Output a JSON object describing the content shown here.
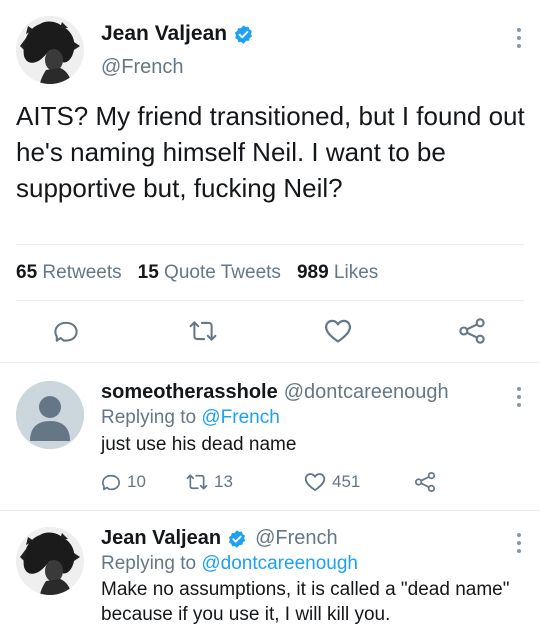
{
  "main_tweet": {
    "display_name": "Jean Valjean",
    "handle": "@French",
    "text": "AITS? My friend transitioned, but I found out he's naming himself Neil. I want to be supportive but, fucking Neil?",
    "stats": [
      {
        "count": "65",
        "label": "Retweets"
      },
      {
        "count": "15",
        "label": "Quote Tweets"
      },
      {
        "count": "989",
        "label": "Likes"
      }
    ],
    "actions": [
      "reply-icon",
      "retweet-icon",
      "like-icon",
      "share-icon"
    ]
  },
  "replies": [
    {
      "display_name": "someotherasshole",
      "handle": "@dontcareenough",
      "replying_prefix": "Replying to",
      "replying_to": "@French",
      "text": "just use his dead name",
      "counts": {
        "replies": "10",
        "retweets": "13",
        "likes": "451"
      }
    },
    {
      "display_name": "Jean Valjean",
      "handle": "@French",
      "replying_prefix": "Replying to",
      "replying_to": "@dontcareenough",
      "text": "Make no assumptions, it is called a \"dead name\" because if you use it, I will kill you."
    }
  ],
  "colors": {
    "accent": "#1da1f2",
    "secondary_text": "#657786",
    "icon": "#657786",
    "divider": "#e6ecf0"
  }
}
